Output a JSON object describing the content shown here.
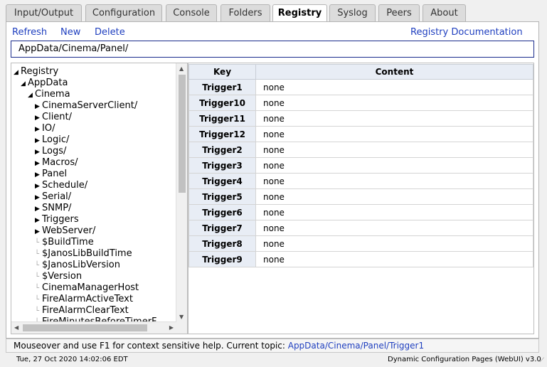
{
  "tabs": [
    {
      "label": "Input/Output",
      "active": false
    },
    {
      "label": "Configuration",
      "active": false
    },
    {
      "label": "Console",
      "active": false
    },
    {
      "label": "Folders",
      "active": false
    },
    {
      "label": "Registry",
      "active": true
    },
    {
      "label": "Syslog",
      "active": false
    },
    {
      "label": "Peers",
      "active": false
    },
    {
      "label": "About",
      "active": false
    }
  ],
  "toolbar": {
    "refresh_label": "Refresh",
    "new_label": "New",
    "delete_label": "Delete",
    "docs_label": "Registry Documentation"
  },
  "path_value": "AppData/Cinema/Panel/",
  "tree": [
    {
      "label": "Registry",
      "kind": "expanded",
      "depth": 0
    },
    {
      "label": "AppData",
      "kind": "expanded",
      "depth": 1
    },
    {
      "label": "Cinema",
      "kind": "expanded",
      "depth": 2
    },
    {
      "label": "CinemaServerClient/",
      "kind": "collapsed",
      "depth": 3
    },
    {
      "label": "Client/",
      "kind": "collapsed",
      "depth": 3
    },
    {
      "label": "IO/",
      "kind": "collapsed",
      "depth": 3
    },
    {
      "label": "Logic/",
      "kind": "collapsed",
      "depth": 3
    },
    {
      "label": "Logs/",
      "kind": "collapsed",
      "depth": 3
    },
    {
      "label": "Macros/",
      "kind": "collapsed",
      "depth": 3
    },
    {
      "label": "Panel",
      "kind": "collapsed",
      "depth": 3
    },
    {
      "label": "Schedule/",
      "kind": "collapsed",
      "depth": 3
    },
    {
      "label": "Serial/",
      "kind": "collapsed",
      "depth": 3
    },
    {
      "label": "SNMP/",
      "kind": "collapsed",
      "depth": 3
    },
    {
      "label": "Triggers",
      "kind": "collapsed",
      "depth": 3
    },
    {
      "label": "WebServer/",
      "kind": "collapsed",
      "depth": 3
    },
    {
      "label": "$BuildTime",
      "kind": "leaf",
      "depth": 3
    },
    {
      "label": "$JanosLibBuildTime",
      "kind": "leaf",
      "depth": 3
    },
    {
      "label": "$JanosLibVersion",
      "kind": "leaf",
      "depth": 3
    },
    {
      "label": "$Version",
      "kind": "leaf",
      "depth": 3
    },
    {
      "label": "CinemaManagerHost",
      "kind": "leaf",
      "depth": 3
    },
    {
      "label": "FireAlarmActiveText",
      "kind": "leaf",
      "depth": 3
    },
    {
      "label": "FireAlarmClearText",
      "kind": "leaf",
      "depth": 3
    },
    {
      "label": "FireMinutesBeforeTimerF",
      "kind": "leaf",
      "depth": 3
    }
  ],
  "grid": {
    "headers": [
      "Key",
      "Content"
    ],
    "rows": [
      {
        "key": "Trigger1",
        "content": "none"
      },
      {
        "key": "Trigger10",
        "content": "none"
      },
      {
        "key": "Trigger11",
        "content": "none"
      },
      {
        "key": "Trigger12",
        "content": "none"
      },
      {
        "key": "Trigger2",
        "content": "none"
      },
      {
        "key": "Trigger3",
        "content": "none"
      },
      {
        "key": "Trigger4",
        "content": "none"
      },
      {
        "key": "Trigger5",
        "content": "none"
      },
      {
        "key": "Trigger6",
        "content": "none"
      },
      {
        "key": "Trigger7",
        "content": "none"
      },
      {
        "key": "Trigger8",
        "content": "none"
      },
      {
        "key": "Trigger9",
        "content": "none"
      }
    ]
  },
  "help": {
    "text": "Mouseover and use F1 for context sensitive help. Current topic: ",
    "topic": "AppData/Cinema/Panel/Trigger1"
  },
  "status": {
    "timestamp": "Tue, 27 Oct 2020 14:02:06 EDT",
    "app": "Dynamic Configuration Pages (WebUI) v3.0"
  },
  "icons": {
    "expanded": "triangle-down-left-icon",
    "collapsed": "triangle-right-icon",
    "leaf": "tree-branch-icon"
  }
}
